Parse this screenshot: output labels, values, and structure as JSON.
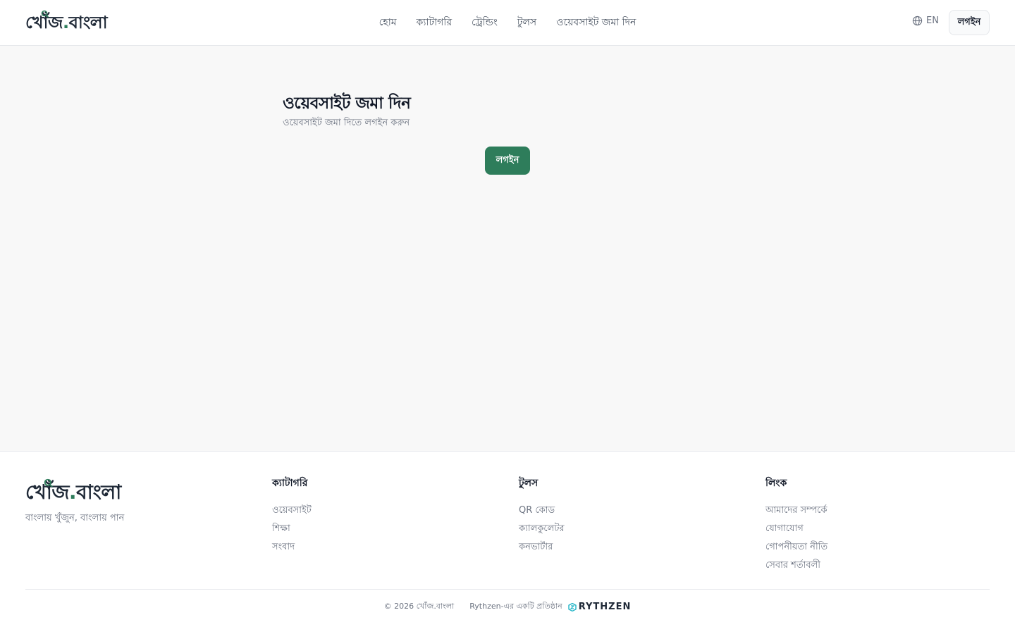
{
  "header": {
    "logo_main": "খোঁজ",
    "logo_dot": ".",
    "logo_rest": "বাংলা",
    "nav": [
      {
        "label": "হোম"
      },
      {
        "label": "ক্যাটাগরি"
      },
      {
        "label": "ট্রেন্ডিং"
      },
      {
        "label": "টুলস"
      },
      {
        "label": "ওয়েবসাইট জমা দিন"
      }
    ],
    "lang_label": "EN",
    "login_label": "লগইন"
  },
  "main": {
    "title": "ওয়েবসাইট জমা দিন",
    "subtitle": "ওয়েবসাইট জমা দিতে লগইন করুন",
    "login_label": "লগইন"
  },
  "footer": {
    "logo_main": "খোঁজ",
    "logo_dot": ".",
    "logo_rest": "বাংলা",
    "tagline": "বাংলায় খুঁজুন, বাংলায় পান",
    "columns": [
      {
        "title": "ক্যাটাগরি",
        "links": [
          "ওয়েবসাইট",
          "শিক্ষা",
          "সংবাদ"
        ]
      },
      {
        "title": "টুলস",
        "links": [
          "QR কোড",
          "ক্যালকুলেটর",
          "কনভার্টার"
        ]
      },
      {
        "title": "লিংক",
        "links": [
          "আমাদের সম্পর্কে",
          "যোগাযোগ",
          "গোপনীয়তা নীতি",
          "সেবার শর্তাবলী"
        ]
      }
    ],
    "copyright": "© 2026 খোঁজ.বাংলা",
    "org_text": "Rythzen-এর একটি প্রতিষ্ঠান",
    "brand": "RYTHZEN"
  },
  "colors": {
    "accent": "#2e7d5b",
    "background": "#f8f8f8"
  },
  "icons": [
    "magnifier-icon",
    "globe-icon",
    "rythzen-logo-icon"
  ]
}
